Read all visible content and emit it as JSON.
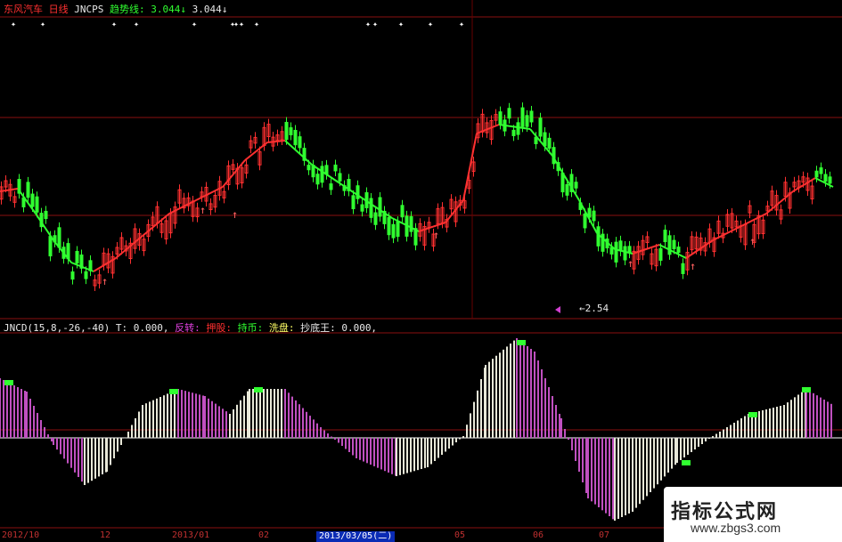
{
  "header": {
    "stock_name": "东风汽车",
    "period": "日线",
    "indicator": "JNCPS",
    "trend_label": "趋势线:",
    "trend_value_a": "3.044",
    "trend_value_b": "3.044"
  },
  "sub_header": {
    "indicator": "JNCD(15,8,-26,-40)",
    "t_label": "T: 0.000,",
    "fanzhuan": "反转:",
    "yagu": "押股:",
    "chibi": "持币:",
    "xipan": "洗盘:",
    "chaodiwang": "抄底王: 0.000,"
  },
  "price_flag": "←2.54",
  "date_axis": {
    "labels": [
      "2012/10",
      "12",
      "2013/01",
      "02",
      "05",
      "06",
      "07"
    ],
    "cursor": "2013/03/05(二)"
  },
  "watermark": {
    "title": "指标公式网",
    "site": "www.zbgs3.com"
  },
  "colors": {
    "up": "#ff3030",
    "down": "#30ff30",
    "neutral": "#e8e8e8",
    "magenta": "#c050c0",
    "grid": "#8a1010",
    "highlight_green": "#30ff30"
  }
}
